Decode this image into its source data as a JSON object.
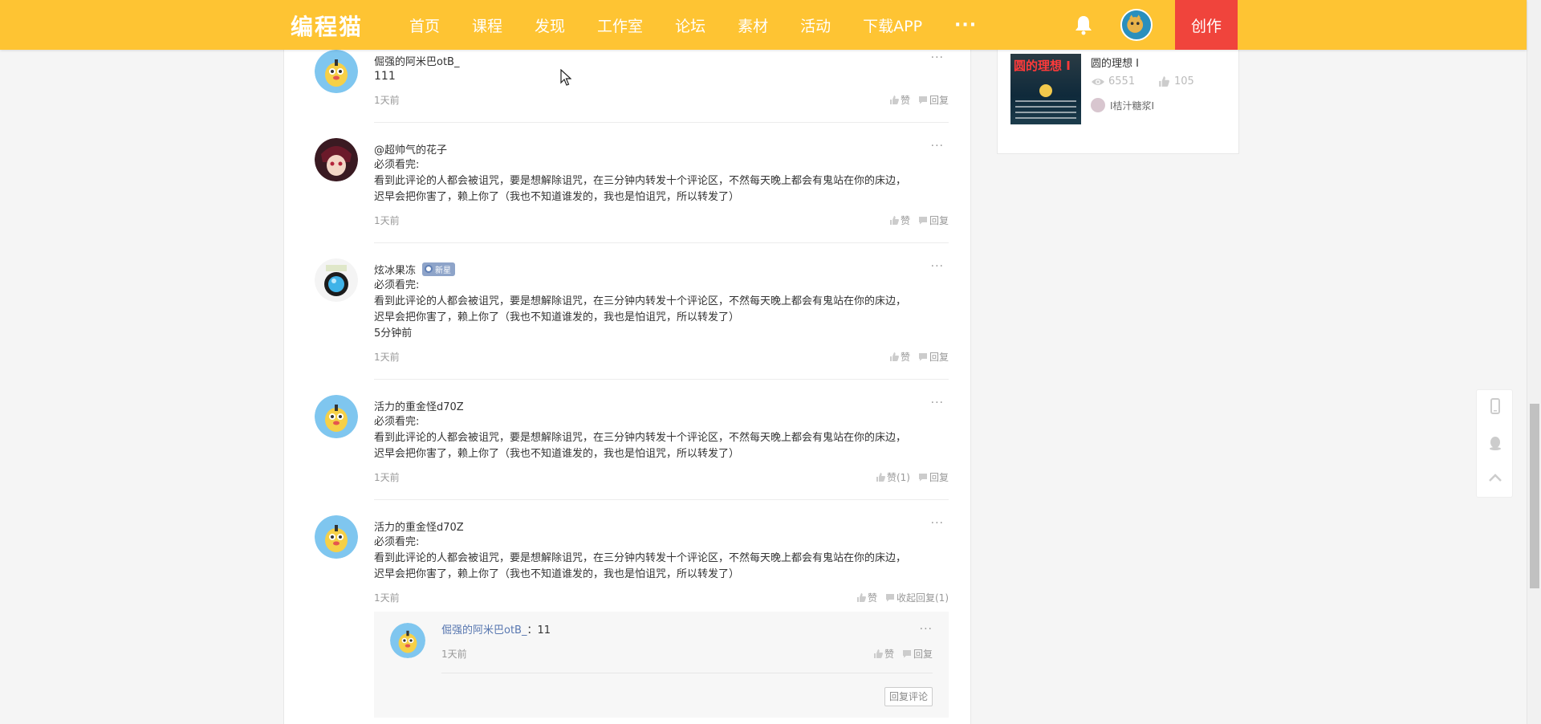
{
  "header": {
    "logo": "编程猫",
    "nav": [
      "首页",
      "课程",
      "发现",
      "工作室",
      "论坛",
      "素材",
      "活动",
      "下载APP"
    ],
    "more": "···",
    "create_label": "创作",
    "accent_color": "#fec433",
    "create_color": "#f0443c"
  },
  "comments": [
    {
      "user": "倔强的阿米巴otB_",
      "lines": [
        "111"
      ],
      "time": "1天前",
      "like_label": "赞",
      "reply_label": "回复"
    },
    {
      "user": "@超帅气的花子",
      "lines": [
        "必须看完:",
        "看到此评论的人都会被诅咒，要是想解除诅咒，在三分钟内转发十个评论区，不然每天晚上都会有鬼站在你的床边，",
        "迟早会把你害了，赖上你了（我也不知道谁发的，我也是怕诅咒，所以转发了）"
      ],
      "time": "1天前",
      "like_label": "赞",
      "reply_label": "回复"
    },
    {
      "user": "炫冰果冻",
      "badge": "新星",
      "lines": [
        "必须看完:",
        "看到此评论的人都会被诅咒，要是想解除诅咒，在三分钟内转发十个评论区，不然每天晚上都会有鬼站在你的床边，",
        "迟早会把你害了，赖上你了（我也不知道谁发的，我也是怕诅咒，所以转发了）",
        "5分钟前"
      ],
      "time": "1天前",
      "like_label": "赞",
      "reply_label": "回复"
    },
    {
      "user": "活力的重金怪d70Z",
      "lines": [
        "必须看完:",
        "看到此评论的人都会被诅咒，要是想解除诅咒，在三分钟内转发十个评论区，不然每天晚上都会有鬼站在你的床边，",
        "迟早会把你害了，赖上你了（我也不知道谁发的，我也是怕诅咒，所以转发了）"
      ],
      "time": "1天前",
      "like_label": "赞(1)",
      "reply_label": "回复"
    },
    {
      "user": "活力的重金怪d70Z",
      "lines": [
        "必须看完:",
        "看到此评论的人都会被诅咒，要是想解除诅咒，在三分钟内转发十个评论区，不然每天晚上都会有鬼站在你的床边，",
        "迟早会把你害了，赖上你了（我也不知道谁发的，我也是怕诅咒，所以转发了）"
      ],
      "time": "1天前",
      "like_label": "赞",
      "reply_label": "收起回复(1)"
    }
  ],
  "reply": {
    "user": "倔强的阿米巴otB_",
    "text": "：11",
    "time": "1天前",
    "like_label": "赞",
    "reply_label": "回复",
    "reply_comment_button": "回复评论"
  },
  "sidebar_work": {
    "cover_title": "圆的理想 I",
    "title": "圆的理想 I",
    "views": "6551",
    "likes": "105",
    "author": "I桔汁糖浆I"
  },
  "more_dots": "···"
}
